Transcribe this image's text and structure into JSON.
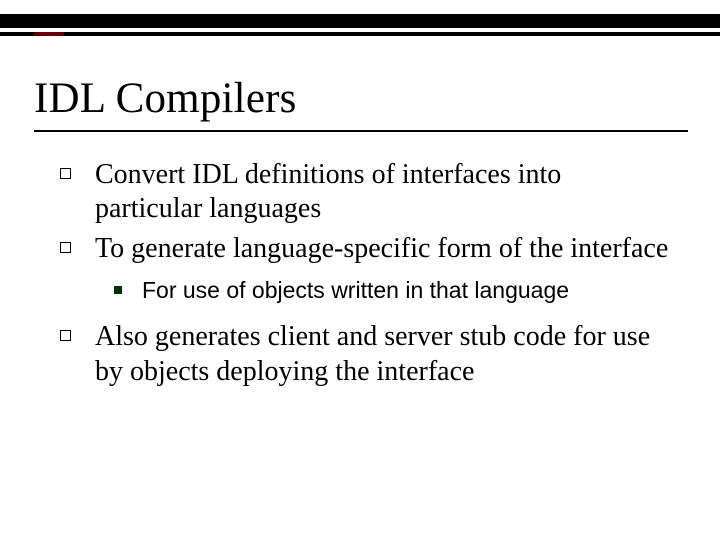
{
  "slide": {
    "title": "IDL Compilers",
    "bullets": {
      "b1": "Convert IDL definitions of interfaces into particular languages",
      "b2": "To generate language-specific form of the interface",
      "b2_sub1": "For use of objects written in that language",
      "b3": "Also generates client and server stub code for use by objects deploying the interface"
    }
  }
}
